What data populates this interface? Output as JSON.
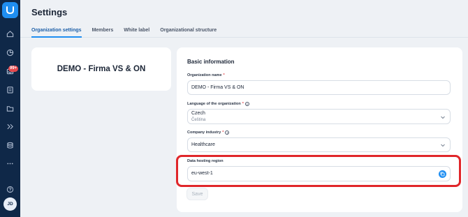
{
  "sidebar": {
    "logo": "brand-logo-icon",
    "items": [
      {
        "icon": "home-icon"
      },
      {
        "icon": "pie-chart-icon"
      },
      {
        "icon": "inbox-icon",
        "badge": "99+"
      },
      {
        "icon": "clipboard-icon"
      },
      {
        "icon": "folder-icon"
      },
      {
        "icon": "chevrons-right-icon"
      },
      {
        "icon": "database-icon"
      },
      {
        "icon": "more-icon"
      },
      {
        "icon": "help-icon"
      }
    ],
    "avatar_initials": "JD"
  },
  "page": {
    "title": "Settings",
    "tabs": [
      {
        "label": "Organization settings",
        "active": true
      },
      {
        "label": "Members",
        "active": false
      },
      {
        "label": "White label",
        "active": false
      },
      {
        "label": "Organizational structure",
        "active": false
      }
    ]
  },
  "org_card": {
    "name": "DEMO - Firma VS & ON"
  },
  "form": {
    "section_title": "Basic information",
    "org_name": {
      "label": "Organization name",
      "required": "*",
      "value": "DEMO - Firma VS & ON"
    },
    "language": {
      "label": "Language of the organization",
      "required": "*",
      "value": "Czech",
      "sub_value": "Čeština"
    },
    "industry": {
      "label": "Company industry",
      "required": "*",
      "value": "Healthcare"
    },
    "region": {
      "label": "Data hosting region",
      "value": "eu-west-1"
    },
    "save_label": "Save"
  },
  "colors": {
    "sidebar": "#0f2848",
    "accent": "#1f8ef1",
    "highlight": "#e0262a",
    "badge": "#e5484d"
  }
}
